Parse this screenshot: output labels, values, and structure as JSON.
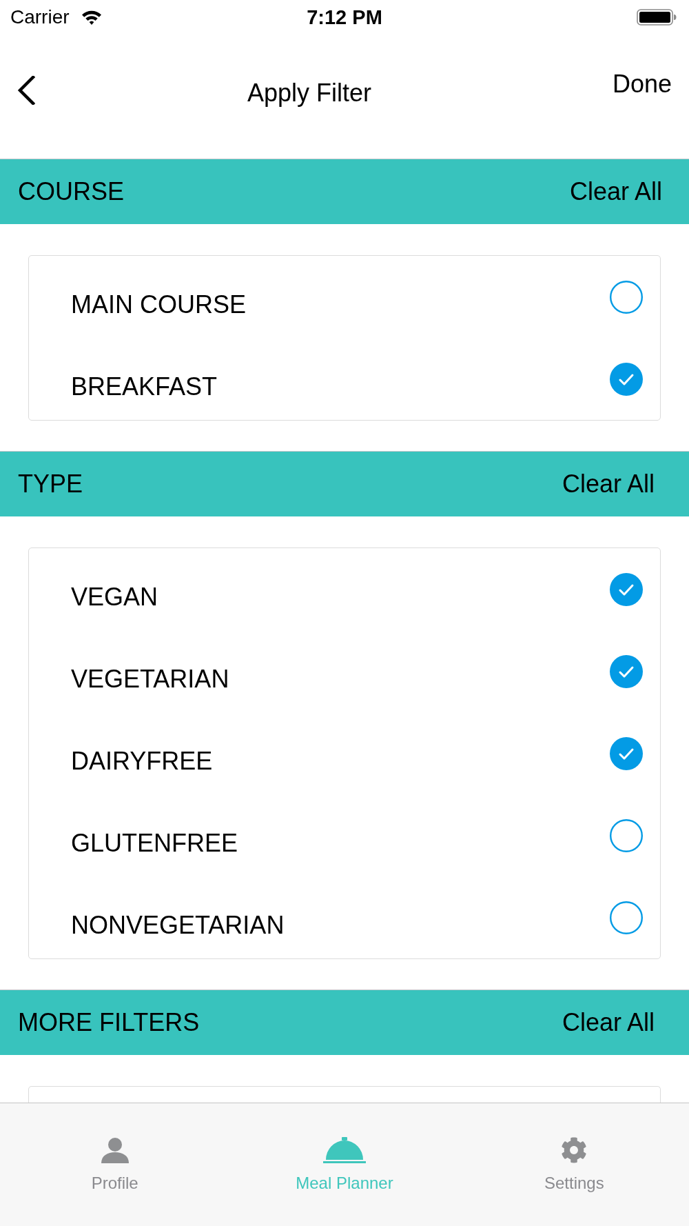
{
  "status_bar": {
    "carrier": "Carrier",
    "time": "7:12 PM"
  },
  "nav_bar": {
    "title": "Apply Filter",
    "done_button": "Done"
  },
  "sections": [
    {
      "title": "COURSE",
      "clear_button": "Clear All",
      "options": [
        {
          "label": "MAIN COURSE",
          "checked": false
        },
        {
          "label": "BREAKFAST",
          "checked": true
        }
      ]
    },
    {
      "title": "TYPE",
      "clear_button": "Clear All",
      "options": [
        {
          "label": "VEGAN",
          "checked": true
        },
        {
          "label": "VEGETARIAN",
          "checked": true
        },
        {
          "label": "DAIRYFREE",
          "checked": true
        },
        {
          "label": "GLUTENFREE",
          "checked": false
        },
        {
          "label": "NONVEGETARIAN",
          "checked": false
        }
      ]
    },
    {
      "title": "MORE FILTERS",
      "clear_button": "Clear All"
    }
  ],
  "tab_bar": {
    "tabs": [
      {
        "label": "Profile",
        "selected": false
      },
      {
        "label": "Meal Planner",
        "selected": true
      },
      {
        "label": "Settings",
        "selected": false
      }
    ]
  }
}
